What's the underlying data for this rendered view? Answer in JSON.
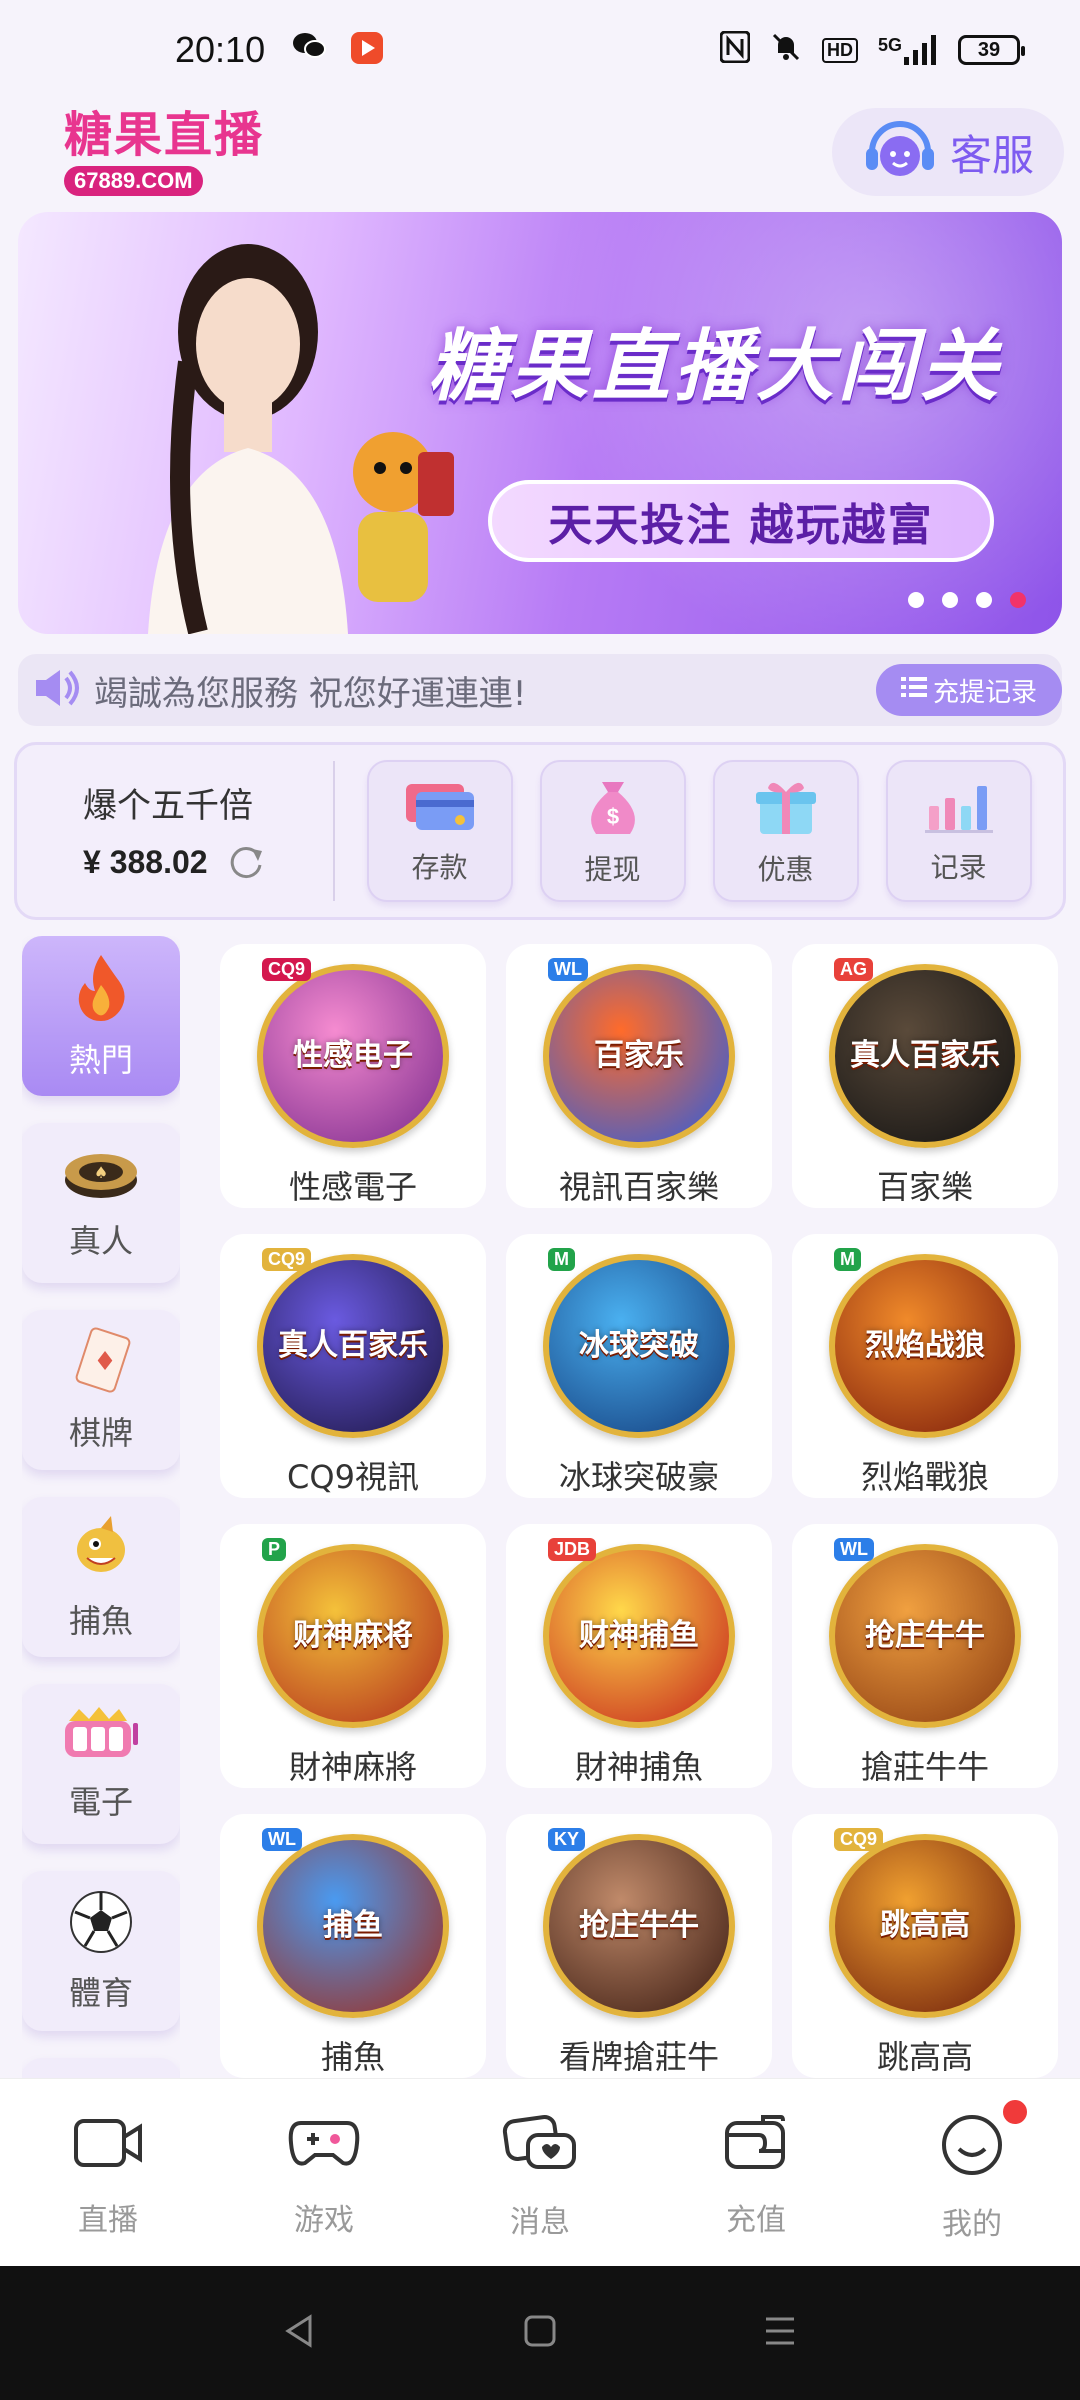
{
  "status_bar": {
    "time": "20:10",
    "network": "5G",
    "hd": "HD",
    "battery": "39"
  },
  "header": {
    "logo_title": "糖果直播",
    "logo_sub": "67889.COM",
    "customer_service": "客服"
  },
  "banner": {
    "headline": "糖果直播大闯关",
    "tagline": "天天投注 越玩越富",
    "slide_count": 4,
    "active_slide": 4
  },
  "notice": {
    "text": "竭誠為您服務 祝您好運連連!",
    "record_button": "充提记录"
  },
  "wallet": {
    "username": "爆个五千倍",
    "balance": "¥ 388.02",
    "actions": [
      {
        "label": "存款",
        "icon": "card-icon"
      },
      {
        "label": "提现",
        "icon": "money-bag-icon"
      },
      {
        "label": "优惠",
        "icon": "gift-icon"
      },
      {
        "label": "记录",
        "icon": "bar-chart-icon"
      }
    ]
  },
  "categories": [
    {
      "label": "熱門",
      "icon": "fire-icon",
      "active": true
    },
    {
      "label": "真人",
      "icon": "chip-icon"
    },
    {
      "label": "棋牌",
      "icon": "card-icon"
    },
    {
      "label": "捕魚",
      "icon": "fish-icon"
    },
    {
      "label": "電子",
      "icon": "slot-icon"
    },
    {
      "label": "體育",
      "icon": "soccer-icon"
    }
  ],
  "games": [
    {
      "name": "性感電子",
      "brand": "CQ9",
      "art": "性感电子",
      "colors": [
        "#f58bd0",
        "#7a2a8c"
      ],
      "brand_color": "#d4184e"
    },
    {
      "name": "視訊百家樂",
      "brand": "WL",
      "art": "百家乐",
      "colors": [
        "#ff6b2a",
        "#2a5ce0"
      ],
      "brand_color": "#2c7ee8"
    },
    {
      "name": "百家樂",
      "brand": "AG",
      "art": "真人百家乐",
      "colors": [
        "#5a4a3a",
        "#111111"
      ],
      "brand_color": "#e8413a"
    },
    {
      "name": "CQ9視訊",
      "brand": "CQ9",
      "art": "真人百家乐",
      "colors": [
        "#6a5ae0",
        "#1a1440"
      ],
      "brand_color": "#e2b33c"
    },
    {
      "name": "冰球突破豪",
      "brand": "M",
      "art": "冰球突破",
      "colors": [
        "#4ab0f0",
        "#123a7a"
      ],
      "brand_color": "#22a34a"
    },
    {
      "name": "烈焰戰狼",
      "brand": "M",
      "art": "烈焰战狼",
      "colors": [
        "#f08a2a",
        "#7a1a0a"
      ],
      "brand_color": "#22a34a"
    },
    {
      "name": "財神麻將",
      "brand": "P",
      "art": "财神麻将",
      "colors": [
        "#f4c13a",
        "#b02a1a"
      ],
      "brand_color": "#22a34a"
    },
    {
      "name": "財神捕魚",
      "brand": "JDB",
      "art": "财神捕鱼",
      "colors": [
        "#ffd84a",
        "#c4201a"
      ],
      "brand_color": "#e8413a"
    },
    {
      "name": "搶莊牛牛",
      "brand": "WL",
      "art": "抢庄牛牛",
      "colors": [
        "#f0a040",
        "#8a3a10"
      ],
      "brand_color": "#2c7ee8"
    },
    {
      "name": "捕魚",
      "brand": "WL",
      "art": "捕鱼",
      "colors": [
        "#4a9af0",
        "#a02a1a"
      ],
      "brand_color": "#2c7ee8"
    },
    {
      "name": "看牌搶莊牛",
      "brand": "KY",
      "art": "抢庄牛牛",
      "colors": [
        "#c08a6a",
        "#3a1a10"
      ],
      "brand_color": "#2c7ee8"
    },
    {
      "name": "跳高高",
      "brand": "CQ9",
      "art": "跳高高",
      "colors": [
        "#f0a030",
        "#6a1a0a"
      ],
      "brand_color": "#e2b33c"
    }
  ],
  "tabbar": [
    {
      "label": "直播",
      "icon": "camera-icon"
    },
    {
      "label": "游戏",
      "icon": "gamepad-icon"
    },
    {
      "label": "消息",
      "icon": "chat-icon"
    },
    {
      "label": "充值",
      "icon": "wallet-icon"
    },
    {
      "label": "我的",
      "icon": "profile-icon",
      "badge": true
    }
  ],
  "theme": {
    "accent": "#8e54e9",
    "brand_pink": "#e8358f"
  }
}
